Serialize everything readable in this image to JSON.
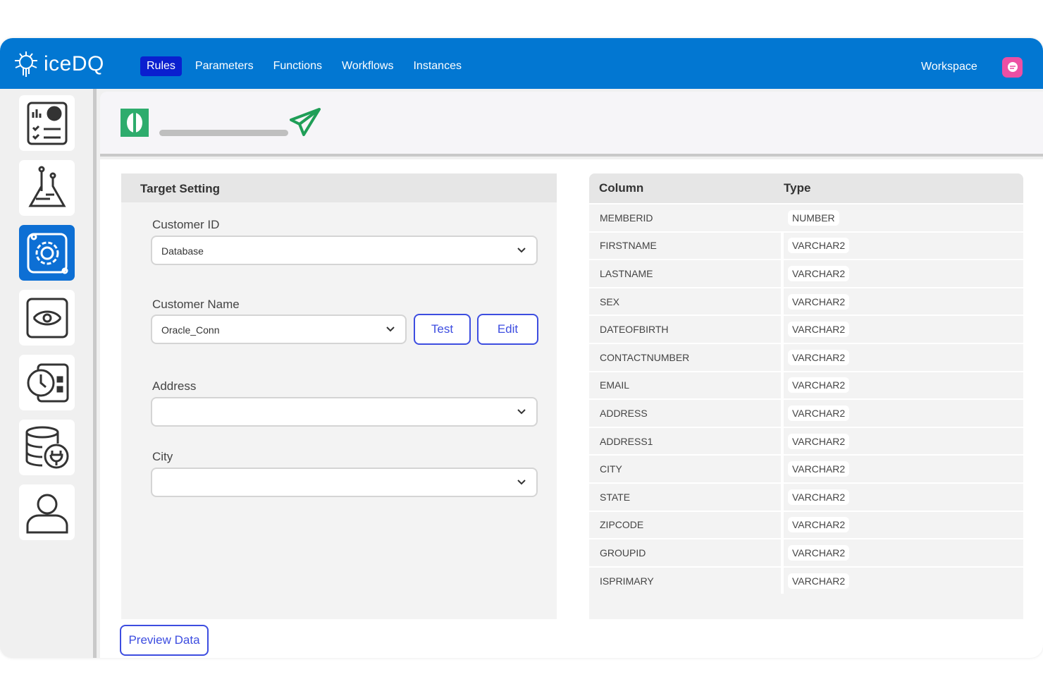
{
  "header": {
    "brand": "iceDQ",
    "nav": [
      "Rules",
      "Parameters",
      "Functions",
      "Workflows",
      "Instances"
    ],
    "active_nav": "Rules",
    "workspace": "Workspace"
  },
  "colors": {
    "header": "#0277d2",
    "active_nav": "#0a1fcf",
    "accent": "#3d4de0",
    "status_green": "#2eac6d"
  },
  "sidebar": {
    "items": [
      "dashboard-icon",
      "lab-flask-icon",
      "rules-gear-icon",
      "compare-icon",
      "schedule-icon",
      "database-connection-icon",
      "user-icon"
    ],
    "active_index": 2
  },
  "target": {
    "title": "Target Setting",
    "fields": [
      {
        "label": "Customer ID",
        "value": "Database"
      },
      {
        "label": "Customer Name",
        "value": "Oracle_Conn"
      },
      {
        "label": "Address",
        "value": ""
      },
      {
        "label": "City",
        "value": ""
      }
    ],
    "test_label": "Test",
    "edit_label": "Edit",
    "preview_label": "Preview Data"
  },
  "table": {
    "headers": [
      "Column",
      "Type"
    ],
    "rows": [
      [
        "MEMBERID",
        "NUMBER"
      ],
      [
        "FIRSTNAME",
        "VARCHAR2"
      ],
      [
        "LASTNAME",
        "VARCHAR2"
      ],
      [
        "SEX",
        "VARCHAR2"
      ],
      [
        "DATEOFBIRTH",
        "VARCHAR2"
      ],
      [
        "CONTACTNUMBER",
        "VARCHAR2"
      ],
      [
        "EMAIL",
        "VARCHAR2"
      ],
      [
        "ADDRESS",
        "VARCHAR2"
      ],
      [
        "ADDRESS1",
        "VARCHAR2"
      ],
      [
        "CITY",
        "VARCHAR2"
      ],
      [
        "STATE",
        "VARCHAR2"
      ],
      [
        "ZIPCODE",
        "VARCHAR2"
      ],
      [
        "GROUPID",
        "VARCHAR2"
      ],
      [
        "ISPRIMARY",
        "VARCHAR2"
      ]
    ]
  }
}
